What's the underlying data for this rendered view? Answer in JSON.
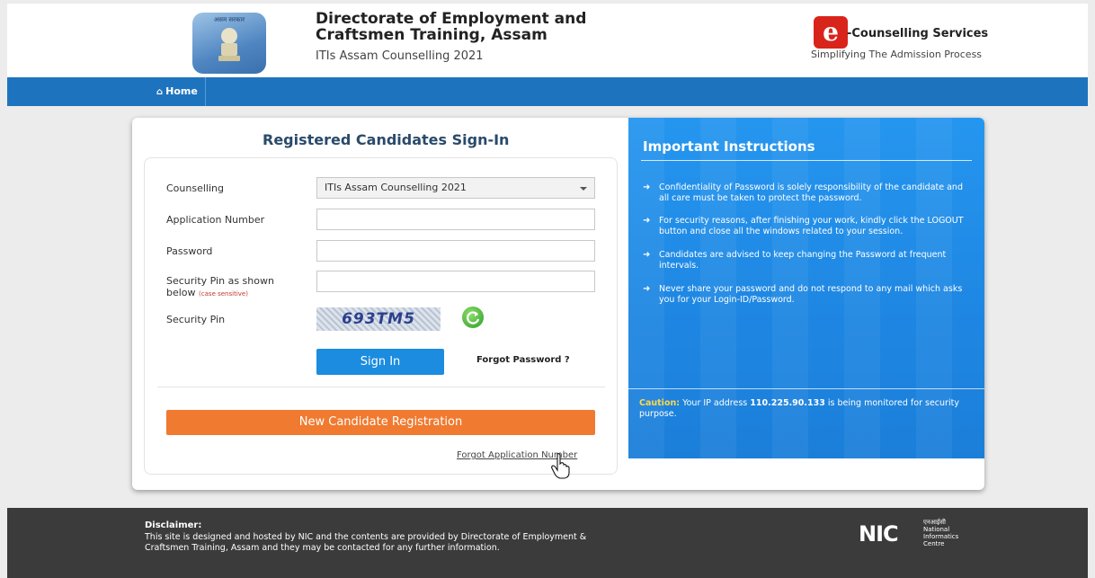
{
  "header": {
    "emblem_text": "असम सरकार",
    "title_line1": "Directorate of Employment and",
    "title_line2": "Craftsmen Training, Assam",
    "subtitle": "ITIs Assam Counselling 2021",
    "ec_logo_letter": "e",
    "ec_title": "-Counselling Services",
    "ec_tagline": "Simplifying The Admission Process"
  },
  "nav": {
    "home_label": "Home"
  },
  "signin": {
    "title": "Registered Candidates Sign-In",
    "counselling_label": "Counselling",
    "counselling_value": "ITIs Assam Counselling 2021",
    "application_label": "Application Number",
    "application_value": "",
    "password_label": "Password",
    "password_value": "",
    "secpin_label": "Security Pin as shown below",
    "secpin_note": "(case sensitive)",
    "secpin_value": "",
    "captcha_label": "Security Pin",
    "captcha_text": "693TM5",
    "signin_button": "Sign In",
    "forgot_password": "Forgot Password ?",
    "register_button": "New Candidate Registration",
    "forgot_application": "Forgot Application Number"
  },
  "instructions": {
    "title": "Important Instructions",
    "items": [
      "Confidentiality of Password is solely responsibility of the candidate and all care must be taken to protect the password.",
      "For security reasons, after finishing your work, kindly click the LOGOUT button and close all the windows related to your session.",
      "Candidates are advised to keep changing the Password at frequent intervals.",
      "Never share your password and do not respond to any mail which asks you for your Login-ID/Password."
    ],
    "caution_label": "Caution:",
    "caution_pre": "Your IP address",
    "caution_ip": "110.225.90.133",
    "caution_post": "is being monitored for security purpose."
  },
  "footer": {
    "disclaimer_title": "Disclaimer:",
    "disclaimer_text": "This site is designed and hosted by NIC and the contents are provided by Directorate of Employment & Craftsmen Training, Assam and they may be contacted for any further information.",
    "nic_logo": "NIC",
    "nic_hindi": "एनआईसी",
    "nic_line1": "National",
    "nic_line2": "Informatics",
    "nic_line3": "Centre"
  },
  "colors": {
    "nav": "#1e73be",
    "signin_button": "#1b8cdf",
    "register_button": "#f07a30",
    "instructions_panel": "#1e86e2",
    "footer": "#3b3b3b"
  }
}
